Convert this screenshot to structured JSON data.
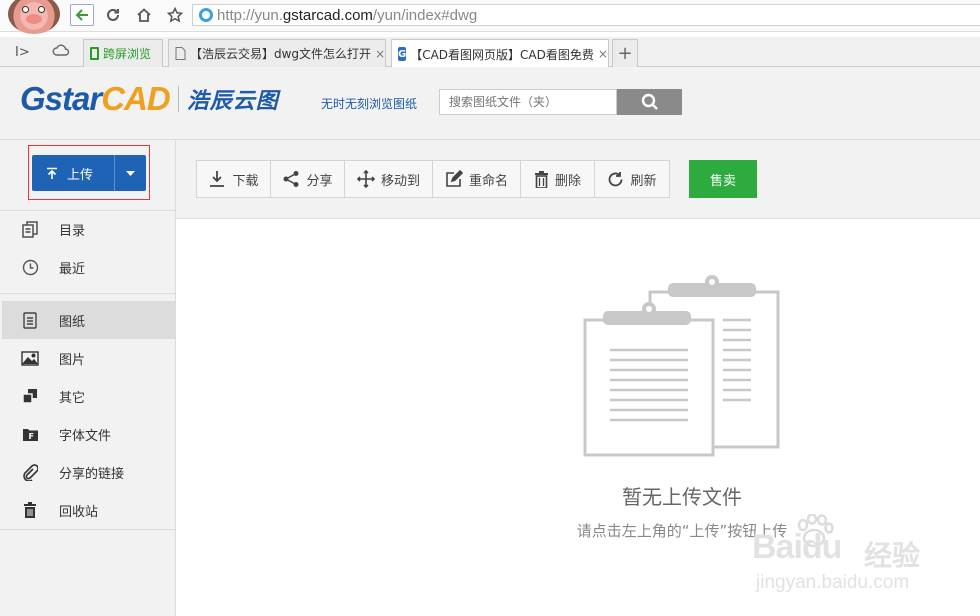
{
  "browser": {
    "url_prefix": "http://yun.",
    "url_host": "gstarcad.com",
    "url_suffix": "/yun/index#dwg",
    "tabs": [
      {
        "label": "跨屏浏览"
      },
      {
        "label": "【浩辰云交易】dwg文件怎么打开"
      },
      {
        "label": "【CAD看图网页版】CAD看图免费"
      }
    ],
    "new_tab": "+",
    "close_glyph": "×"
  },
  "header": {
    "logo_gstar": "Gstar",
    "logo_cad": "CAD",
    "logo_cloud": "浩辰云图",
    "slogan": "无时无刻浏览图纸",
    "search_placeholder": "搜索图纸文件（夹）",
    "colors": {
      "brand_blue": "#1e5aa8",
      "brand_orange": "#f0a020"
    }
  },
  "sidebar": {
    "upload_label": "上传",
    "group1": [
      {
        "label": "目录",
        "icon": "copy-icon"
      },
      {
        "label": "最近",
        "icon": "clock-icon"
      }
    ],
    "group2": [
      {
        "label": "图纸",
        "icon": "document-icon",
        "active": true
      },
      {
        "label": "图片",
        "icon": "image-icon"
      },
      {
        "label": "其它",
        "icon": "stack-icon"
      },
      {
        "label": "字体文件",
        "icon": "font-file-icon"
      },
      {
        "label": "分享的链接",
        "icon": "paperclip-icon"
      },
      {
        "label": "回收站",
        "icon": "trash-icon"
      }
    ]
  },
  "toolbar": {
    "download": "下载",
    "share": "分享",
    "move": "移动到",
    "rename": "重命名",
    "delete": "删除",
    "refresh": "刷新",
    "sell": "售卖",
    "colors": {
      "sell_green": "#2eab3f",
      "upload_blue": "#1f63b7"
    }
  },
  "empty": {
    "title": "暂无上传文件",
    "hint": "请点击左上角的“上传”按钮上传"
  },
  "watermark": {
    "logo": "Baidu",
    "brand": "经验",
    "domain": "jingyan.baidu.com"
  }
}
